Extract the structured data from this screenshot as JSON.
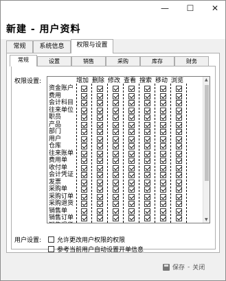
{
  "window": {
    "minimize_glyph": "—",
    "maximize_glyph": "☐",
    "close_glyph": "✕"
  },
  "header": {
    "title": "新建 - 用户资料"
  },
  "outer_tabs": [
    {
      "label": "常规"
    },
    {
      "label": "系统信息"
    },
    {
      "label": "权限与设置",
      "active": true
    }
  ],
  "inner_tabs": [
    {
      "label": "常规",
      "active": true
    },
    {
      "label": "设置"
    },
    {
      "label": "销售"
    },
    {
      "label": "采购"
    },
    {
      "label": "库存"
    },
    {
      "label": "财务"
    }
  ],
  "permissions": {
    "label": "权限设置:",
    "columns": [
      "增加",
      "删除",
      "修改",
      "查看",
      "搜索",
      "移动",
      "浏览"
    ],
    "rows": [
      "资金账户",
      "费用",
      "会计科目",
      "往来单位",
      "职员",
      "产品",
      "部门",
      "用户",
      "仓库",
      "往来账单",
      "费用单",
      "收付单",
      "会计凭证",
      "发票",
      "采购单",
      "采购订单",
      "采购退货",
      "销售单",
      "销售订单",
      "销售退货"
    ]
  },
  "user_settings": {
    "label": "用户设置:",
    "options": [
      {
        "label": "允许更改用户权限的权限",
        "checked": false
      },
      {
        "label": "参考当前用户自动设置开单信息",
        "checked": false
      }
    ]
  },
  "footer": {
    "save_label": "保存",
    "separator": "-",
    "close_label": "关闭"
  }
}
